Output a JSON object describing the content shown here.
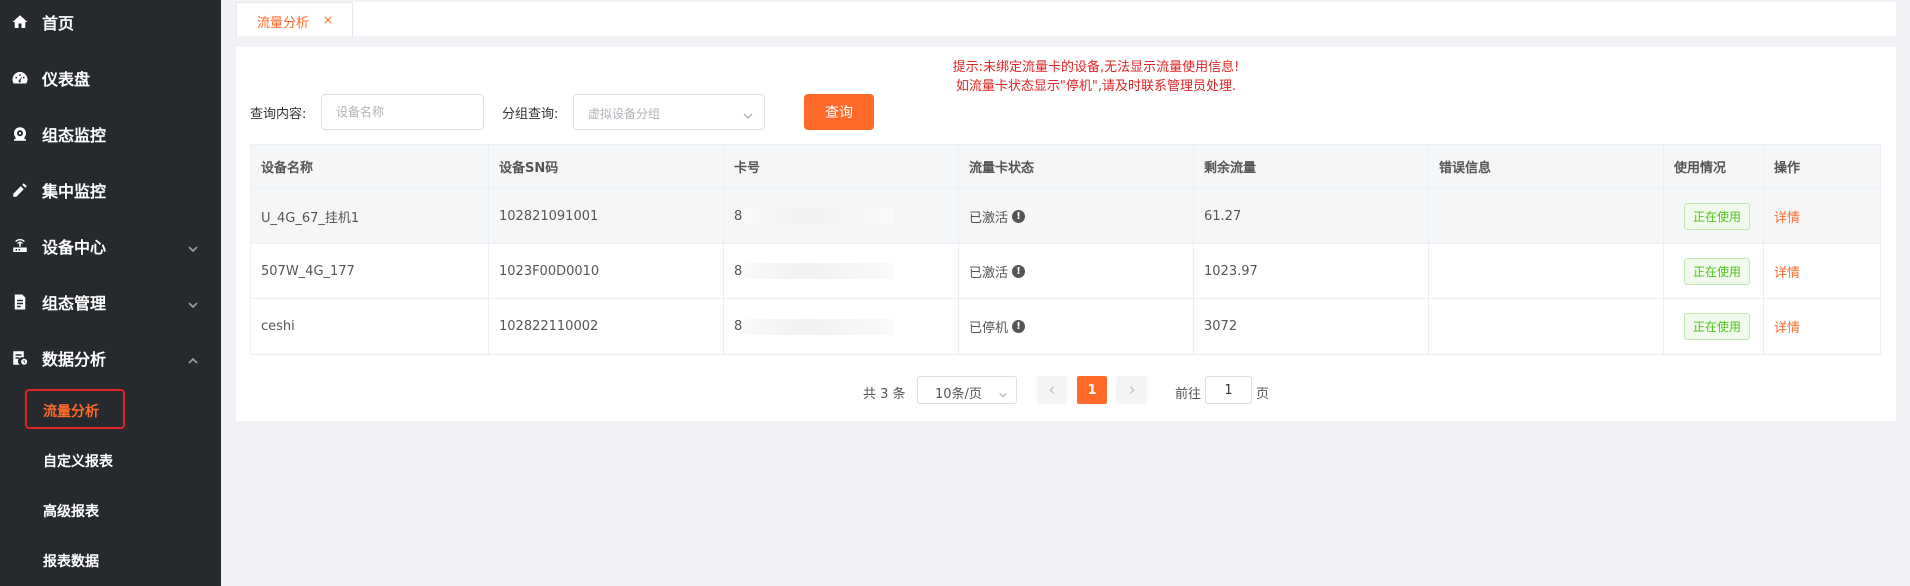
{
  "sidebar": {
    "items": [
      {
        "label": "首页",
        "icon": "home-icon",
        "expandable": false
      },
      {
        "label": "仪表盘",
        "icon": "dashboard-icon",
        "expandable": false
      },
      {
        "label": "组态监控",
        "icon": "monitor-icon",
        "expandable": false
      },
      {
        "label": "集中监控",
        "icon": "tools-icon",
        "expandable": false
      },
      {
        "label": "设备中心",
        "icon": "router-icon",
        "expandable": true
      },
      {
        "label": "组态管理",
        "icon": "document-icon",
        "expandable": true
      },
      {
        "label": "数据分析",
        "icon": "report-icon",
        "expandable": true,
        "expanded": true
      }
    ],
    "sub_items": [
      {
        "label": "流量分析",
        "active": true
      },
      {
        "label": "自定义报表"
      },
      {
        "label": "高级报表"
      },
      {
        "label": "报表数据"
      }
    ]
  },
  "tabs": [
    {
      "label": "流量分析",
      "close": "×"
    }
  ],
  "notice": {
    "line1": "提示:未绑定流量卡的设备,无法显示流量使用信息!",
    "line2": "如流量卡状态显示\"停机\",请及时联系管理员处理."
  },
  "search": {
    "query_label": "查询内容:",
    "query_placeholder": "设备名称",
    "group_label": "分组查询:",
    "group_placeholder": "虚拟设备分组",
    "button_label": "查询"
  },
  "table": {
    "headers": [
      "设备名称",
      "设备SN码",
      "卡号",
      "流量卡状态",
      "剩余流量",
      "错误信息",
      "使用情况",
      "操作"
    ],
    "rows": [
      {
        "name": "U_4G_67_挂机1",
        "sn": "102821091001",
        "card": "8",
        "status": "已激活",
        "remaining": "61.27",
        "error": "",
        "usage": "正在使用",
        "action": "详情"
      },
      {
        "name": "507W_4G_177",
        "sn": "1023F00D0010",
        "card": "8",
        "status": "已激活",
        "remaining": "1023.97",
        "error": "",
        "usage": "正在使用",
        "action": "详情"
      },
      {
        "name": "ceshi",
        "sn": "102822110002",
        "card": "8",
        "status": "已停机",
        "remaining": "3072",
        "error": "",
        "usage": "正在使用",
        "action": "详情"
      }
    ]
  },
  "pagination": {
    "total": "共 3 条",
    "page_size": "10条/页",
    "current_page": "1",
    "goto_label": "前往",
    "goto_value": "1",
    "goto_suffix": "页"
  },
  "colors": {
    "accent": "#ff6a2a",
    "sidebar_bg": "#262a2e",
    "notice": "#e02424",
    "badge_green": "#52c41a"
  }
}
